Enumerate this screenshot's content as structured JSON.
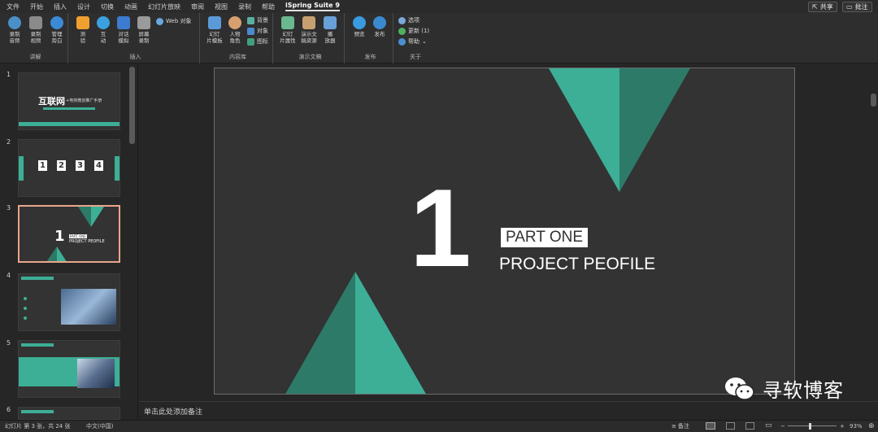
{
  "menu": {
    "items": [
      "文件",
      "开始",
      "插入",
      "设计",
      "切换",
      "动画",
      "幻灯片放映",
      "审阅",
      "视图",
      "录制",
      "帮助",
      "iSpring Suite 9"
    ],
    "share": "共享",
    "comments": "批注"
  },
  "ribbon": {
    "narration": {
      "label": "讲解",
      "buttons": [
        "录制\n音频",
        "录制\n视频",
        "管理\n旁白"
      ]
    },
    "insert": {
      "label": "插入",
      "buttons": [
        "测\n验",
        "互\n动",
        "对话\n模拟",
        "屏幕\n录制"
      ],
      "web": "Web 对象"
    },
    "content": {
      "label": "内容库",
      "buttons": [
        "幻灯\n片模板",
        "人物\n角色"
      ],
      "small": [
        "背景",
        "对象",
        "图标"
      ]
    },
    "presentation": {
      "label": "演示文稿",
      "buttons": [
        "幻灯\n片属性",
        "演示文\n稿资源",
        "播\n放器"
      ]
    },
    "publish": {
      "label": "发布",
      "buttons": [
        "预览",
        "发布"
      ]
    },
    "about": {
      "label": "关于",
      "items": [
        "选项",
        "更新 (1)",
        "帮助"
      ]
    }
  },
  "thumbnails": [
    {
      "num": "1",
      "title": "互联网",
      "subtitle": "+电商微创推广手册"
    },
    {
      "num": "2",
      "boxes": [
        "1",
        "2",
        "3",
        "4"
      ]
    },
    {
      "num": "3",
      "big": "1",
      "tag": "PART ONE",
      "caption": "PROJECT PEOFILE"
    },
    {
      "num": "4"
    },
    {
      "num": "5"
    },
    {
      "num": "6"
    }
  ],
  "slide": {
    "number": "1",
    "part": "PART ONE",
    "title": "PROJECT PEOFILE"
  },
  "notes": "单击此处添加备注",
  "watermark": "寻软博客",
  "status": {
    "slide_info": "幻灯片 第 3 张，共 24 张",
    "language": "中文(中国)",
    "notes_btn": "备注",
    "zoom": "93%"
  },
  "colors": {
    "teal_light": "#3daf96",
    "teal_dark": "#2d7a68",
    "slide_bg": "#333333",
    "selected_border": "#e8a58b"
  }
}
